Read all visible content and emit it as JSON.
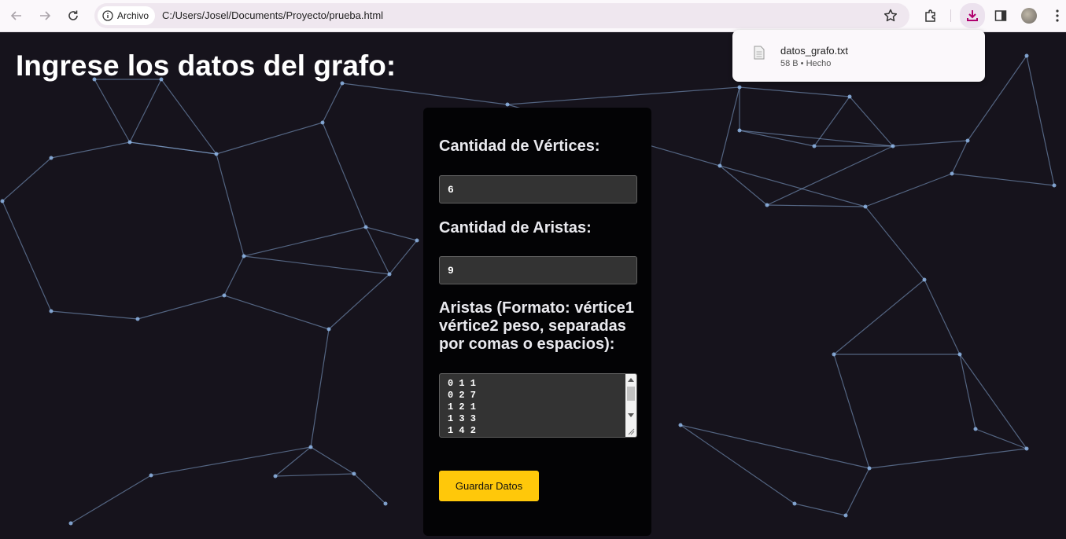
{
  "browser": {
    "site_chip_label": "Archivo",
    "url": "C:/Users/Josel/Documents/Proyecto/prueba.html"
  },
  "download": {
    "filename": "datos_grafo.txt",
    "status": "58 B • Hecho"
  },
  "page": {
    "title": "Ingrese los datos del grafo:"
  },
  "form": {
    "vertices_label": "Cantidad de Vértices:",
    "vertices_value": "6",
    "edges_count_label": "Cantidad de Aristas:",
    "edges_count_value": "9",
    "edges_label": "Aristas (Formato: vértice1 vértice2 peso, separadas por comas o espacios):",
    "edges_visible_text": "0 1 1\n0 2 7\n1 2 1\n1 3 3\n1 4 2",
    "save_button_label": "Guardar Datos"
  },
  "colors": {
    "page_background": "#16131c",
    "network_lines": "#8fb6e6",
    "button_accent": "#ffc80a",
    "download_accent": "#b0006e"
  },
  "icons": [
    "back-icon",
    "forward-icon",
    "reload-icon",
    "info-icon",
    "star-icon",
    "extensions-icon",
    "download-icon",
    "side-panel-icon",
    "avatar",
    "menu-icon",
    "file-icon"
  ]
}
